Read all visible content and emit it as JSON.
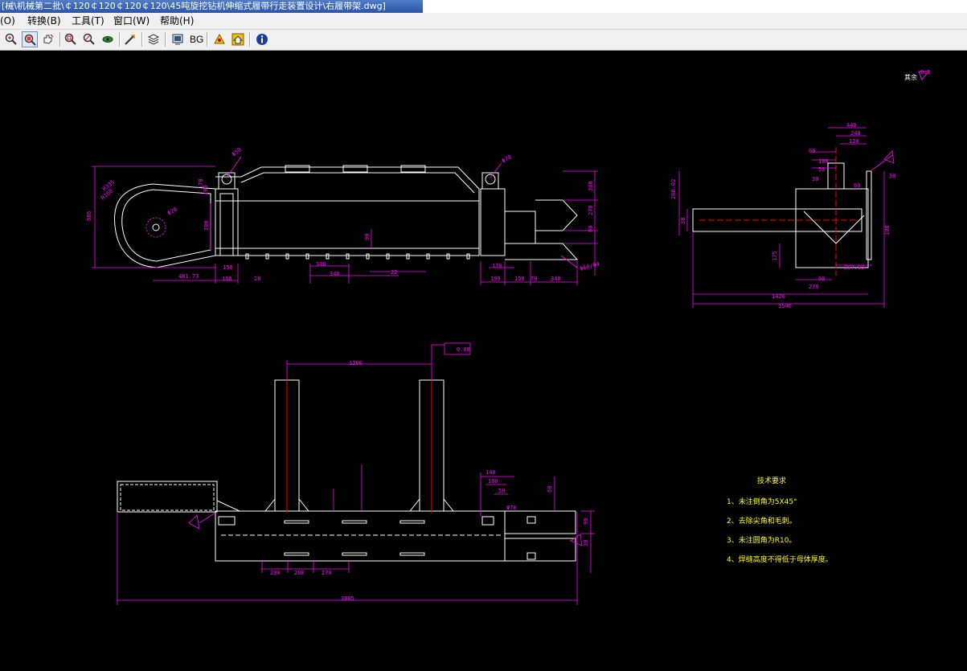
{
  "window": {
    "title": "[械\\机械第二批\\￠120￠120￠120￠120\\45吨旋挖钻机伸缩式履带行走装置设计\\右履带架.dwg]"
  },
  "menu": {
    "items": [
      {
        "label": "(O)",
        "name": "menu-o"
      },
      {
        "label": "转换(B)",
        "name": "menu-convert"
      },
      {
        "label": "工具(T)",
        "name": "menu-tools"
      },
      {
        "label": "窗口(W)",
        "name": "menu-window"
      },
      {
        "label": "帮助(H)",
        "name": "menu-help"
      }
    ]
  },
  "toolbar": {
    "bg_label": "BG"
  },
  "drawing": {
    "colors": {
      "background": "#000000",
      "outline": "#ffffff",
      "dimension": "#ff00ff",
      "centerline": "#ff0000",
      "note": "#ffff00"
    },
    "surface_mark": "其余",
    "surface_value": "6.3",
    "side_view_dims": {
      "d1": "Φ50",
      "d2": "Φ70",
      "r1": "R335",
      "r2": "R160",
      "h_total": "885",
      "h_190": "190",
      "h_170": "170",
      "h_380": "380",
      "h_360": "360",
      "h_270": "270",
      "h_80": "80",
      "h_90": "90",
      "w_481": "481.73",
      "w_150": "150",
      "w_168": "168",
      "w_20": "20",
      "w_340a": "340",
      "w_340b": "340",
      "w_22": "22",
      "w_199": "199",
      "w_170": "170",
      "w_150b": "150",
      "w_70": "70",
      "w_340c": "340",
      "c1": "Φ20",
      "c2": "Φ68/Φ4"
    },
    "end_view_dims": {
      "w_440": "440",
      "w_240": "240",
      "w_120": "120",
      "w_60": "60",
      "w_100": "100",
      "w_50": "50",
      "w_30": "30",
      "w_60b": "60",
      "w_30b": "30",
      "h_268": "268.02",
      "h_38": "38",
      "h_100": "100",
      "h_175": "175",
      "w_90": "90",
      "w_270": "270",
      "w_297": "297.93",
      "w_1420": "1420",
      "w_1540": "1540"
    },
    "plan_view_dims": {
      "w_1200": "1200",
      "parallel": "0.08",
      "w_140": "140",
      "w_100": "100",
      "w_50": "50",
      "d_70": "Φ70",
      "h_60": "60",
      "w_200a": "200",
      "w_200b": "200",
      "w_270": "270",
      "w_3805": "3805",
      "h_30": "30",
      "h_90": "90"
    },
    "notes": {
      "title": "技术要求",
      "items": [
        "1、未注倒角为5X45°",
        "2、去除尖角和毛刺。",
        "3、未注圆角为R10。",
        "4、焊缝高度不得低于母体厚度。"
      ]
    }
  }
}
